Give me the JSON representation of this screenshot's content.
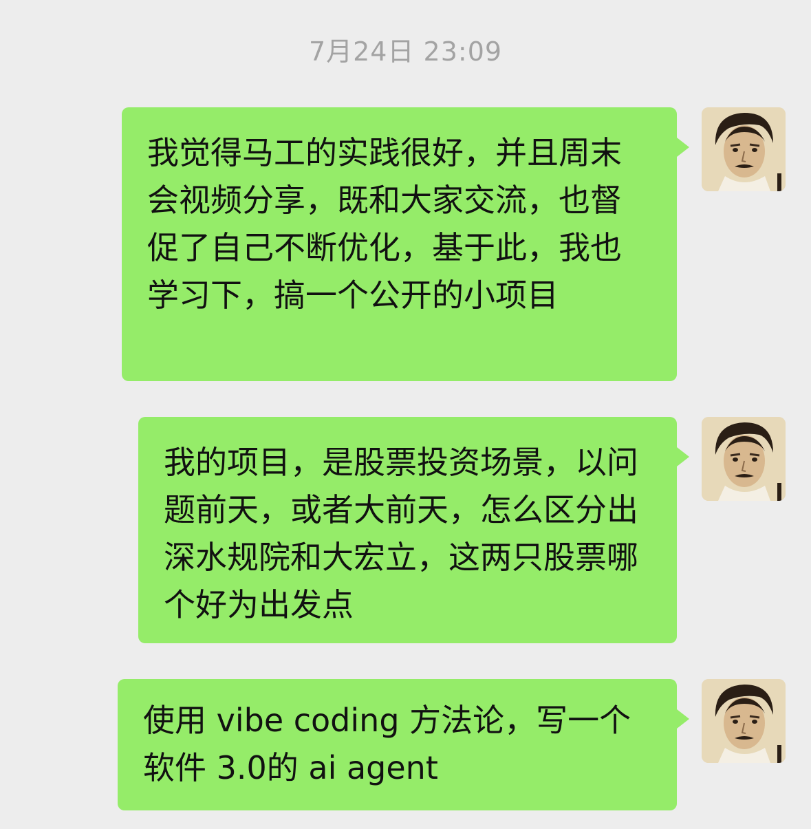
{
  "chat": {
    "timestamp": "7月24日 23:09",
    "messages": [
      {
        "sender": "self",
        "avatar_icon": "user-avatar-portrait-icon",
        "text": "我觉得马工的实践很好，并且周末会视频分享，既和大家交流，也督促了自己不断优化，基于此，我也学习下，搞一个公开的小项目"
      },
      {
        "sender": "self",
        "avatar_icon": "user-avatar-portrait-icon",
        "text": "我的项目，是股票投资场景，以问题前天，或者大前天，怎么区分出深水规院和大宏立，这两只股票哪个好为出发点"
      },
      {
        "sender": "self",
        "avatar_icon": "user-avatar-portrait-icon",
        "text": "使用 vibe coding 方法论，写一个软件 3.0的 ai agent"
      }
    ]
  },
  "colors": {
    "background": "#ededed",
    "bubble": "#95ec69",
    "text": "#111111",
    "timestamp": "#a3a3a3"
  }
}
